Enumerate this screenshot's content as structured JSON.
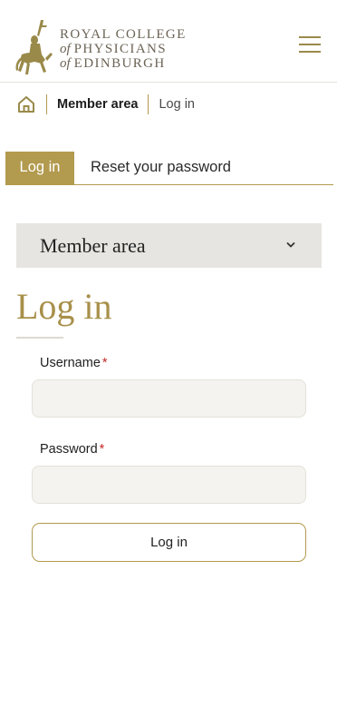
{
  "header": {
    "logo_lines": {
      "line1": "ROYAL COLLEGE",
      "line2_prefix": "of",
      "line2": "PHYSICIANS",
      "line3_prefix": "of",
      "line3": "EDINBURGH"
    },
    "menu_icon": "hamburger-menu-icon"
  },
  "breadcrumb": {
    "home_icon": "home-icon",
    "member_area": "Member area",
    "current": "Log in"
  },
  "tabs": [
    {
      "label": "Log in",
      "active": true
    },
    {
      "label": "Reset your password",
      "active": false
    }
  ],
  "member_dropdown": {
    "label": "Member area",
    "icon": "chevron-down-icon"
  },
  "page": {
    "title": "Log in"
  },
  "form": {
    "username": {
      "label": "Username",
      "required_mark": "*",
      "value": ""
    },
    "password": {
      "label": "Password",
      "required_mark": "*",
      "value": ""
    },
    "submit_label": "Log in"
  },
  "colors": {
    "accent_gold": "#b29a4e",
    "title_gold": "#a8904a",
    "dropdown_bg": "#e6e5e1",
    "input_bg": "#f4f3ef",
    "required_red": "#c62828"
  }
}
